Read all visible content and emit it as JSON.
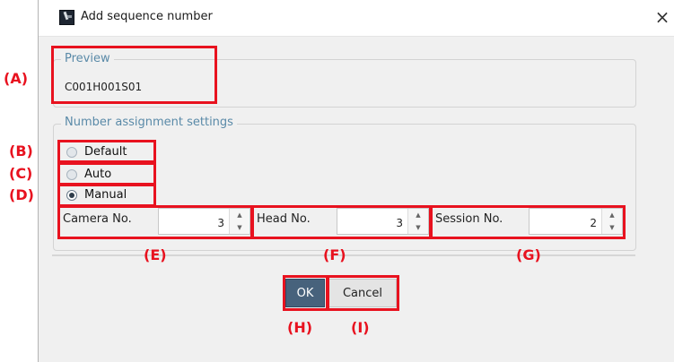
{
  "dialog": {
    "title": "Add sequence number",
    "close_glyph": "×"
  },
  "preview": {
    "legend": "Preview",
    "value": "C001H001S01"
  },
  "assignment": {
    "legend": "Number assignment settings",
    "options": [
      {
        "label": "Default",
        "checked": false
      },
      {
        "label": "Auto",
        "checked": false
      },
      {
        "label": "Manual",
        "checked": true
      }
    ],
    "fields": [
      {
        "label": "Camera No.",
        "value": "3"
      },
      {
        "label": "Head No.",
        "value": "3"
      },
      {
        "label": "Session No.",
        "value": "2"
      }
    ]
  },
  "buttons": {
    "ok": "OK",
    "cancel": "Cancel"
  },
  "spinner_glyphs": {
    "up": "▲",
    "down": "▼"
  },
  "annotations": {
    "A": "(A)",
    "B": "(B)",
    "C": "(C)",
    "D": "(D)",
    "E": "(E)",
    "F": "(F)",
    "G": "(G)",
    "H": "(H)",
    "I": "(I)"
  },
  "colors": {
    "annotation_red": "#e8121f",
    "legend_blue": "#5a8aa8",
    "ok_button": "#47627c"
  }
}
